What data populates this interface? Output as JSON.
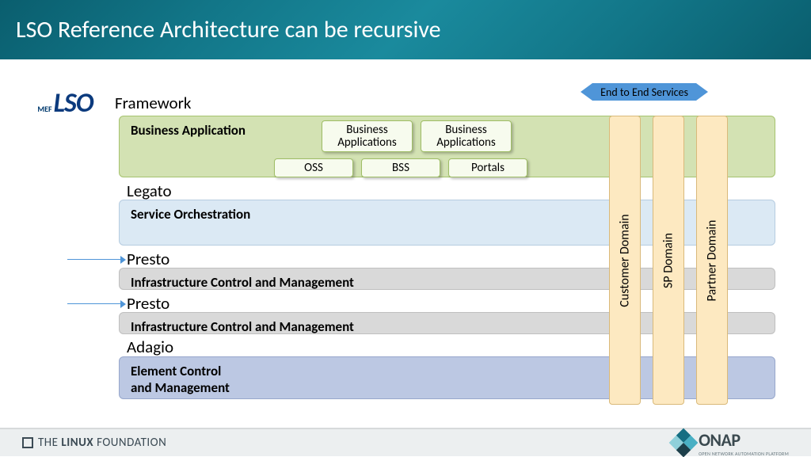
{
  "header": {
    "title": "LSO Reference Architecture can be recursive"
  },
  "logo": {
    "mef": "MEF",
    "lso": "LSO"
  },
  "framework_label": "Framework",
  "e2e_arrow": "End to End Services",
  "layers": {
    "business_app": {
      "title": "Business Application",
      "ba1": "Business\nApplications",
      "ba2": "Business\nApplications",
      "oss": "OSS",
      "bss": "BSS",
      "portals": "Portals"
    },
    "legato_label": "Legato",
    "service_orch": "Service Orchestration",
    "presto_label_1": "Presto",
    "icm1": "Infrastructure Control and Management",
    "presto_label_2": "Presto",
    "icm2": "Infrastructure Control  and Management",
    "adagio_label": "Adagio",
    "ecm": "Element Control\nand Management"
  },
  "domains": {
    "customer": "Customer Domain",
    "sp": "SP Domain",
    "partner": "Partner Domain"
  },
  "footer": {
    "linux_foundation_1": "THE",
    "linux_foundation_2": "LINUX",
    "linux_foundation_3": "FOUNDATION",
    "onap": "ONAP",
    "onap_sub": "OPEN NETWORK AUTOMATION PLATFORM"
  }
}
